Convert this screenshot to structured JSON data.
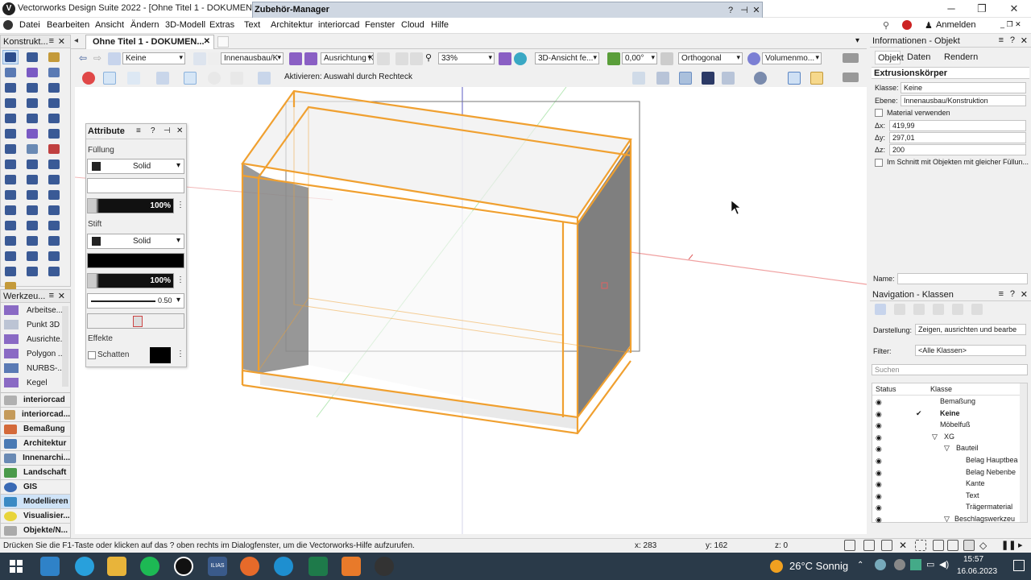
{
  "window": {
    "title": "Vectorworks Design Suite 2022 - [Ohne Titel 1 - DOKUMENT MIT W"
  },
  "dialog": {
    "title": "Zubehör-Manager",
    "help": "?",
    "pin": "⊣",
    "close": "✕"
  },
  "menu": [
    "Datei",
    "Bearbeiten",
    "Ansicht",
    "Ändern",
    "3D-Modell",
    "Extras",
    "Text",
    "Architektur",
    "interiorcad",
    "Fenster",
    "Cloud",
    "Hilfe"
  ],
  "account": {
    "login": "Anmelden"
  },
  "doc_tab": {
    "label": "Ohne Titel 1 - DOKUMEN...",
    "close": "✕"
  },
  "toolbar1": {
    "class_value": "Keine",
    "layer_value": "Innenausbau/K",
    "align_value": "Ausrichtung K...",
    "zoom": "33%",
    "view": "3D-Ansicht fe...",
    "angle": "0,00°",
    "projection": "Orthogonal",
    "render": "Volumenmo..."
  },
  "toolbar2": {
    "hint": "Aktivieren: Auswahl durch Rechteck"
  },
  "palettes": {
    "konstruktion": "Konstrukt...",
    "werkzeug": "Werkzeu..."
  },
  "werkzeug_items": [
    "Arbeitse...",
    "Punkt 3D",
    "Ausrichte...",
    "Polygon ...",
    "NURBS-...",
    "Kegel"
  ],
  "categories": [
    "interiorcad",
    "interiorcad...",
    "Bemaßung",
    "Architektur",
    "Innenarchi...",
    "Landschaft",
    "GIS",
    "Modellieren",
    "Visualisier...",
    "Objekte/N..."
  ],
  "attribute": {
    "title": "Attribute",
    "fill_label": "Füllung",
    "fill_style": "Solid",
    "fill_opacity": "100%",
    "pen_label": "Stift",
    "pen_style": "Solid",
    "pen_opacity": "100%",
    "line_weight": "0.50",
    "effects_label": "Effekte",
    "shadow_label": "Schatten"
  },
  "info": {
    "title": "Informationen - Objekt",
    "tabs": [
      "Objekt",
      "Daten",
      "Rendern"
    ],
    "object_type": "Extrusionskörper",
    "klasse_label": "Klasse:",
    "klasse": "Keine",
    "ebene_label": "Ebene:",
    "ebene": "Innenausbau/Konstruktion",
    "material_label": "Material verwenden",
    "dx_label": "Δx:",
    "dx": "419,99",
    "dy_label": "Δy:",
    "dy": "297,01",
    "dz_label": "Δz:",
    "dz": "200",
    "schnitt_label": "Im Schnitt mit Objekten mit gleicher Füllun...",
    "name_label": "Name:"
  },
  "nav": {
    "title": "Navigation - Klassen",
    "darstellung_label": "Darstellung:",
    "darstellung": "Zeigen, ausrichten und bearbe",
    "filter_label": "Filter:",
    "filter": "<Alle Klassen>",
    "search_placeholder": "Suchen",
    "col_status": "Status",
    "col_klasse": "Klasse",
    "rows": [
      {
        "name": "Bemaßung"
      },
      {
        "name": "Keine"
      },
      {
        "name": "Möbelfuß"
      },
      {
        "name": "XG"
      },
      {
        "name": "Bauteil"
      },
      {
        "name": "Belag Hauptbea"
      },
      {
        "name": "Belag Nebenbe"
      },
      {
        "name": "Kante"
      },
      {
        "name": "Text"
      },
      {
        "name": "Trägermaterial"
      },
      {
        "name": "Beschlagswerkzeu"
      }
    ]
  },
  "status": {
    "help": "Drücken Sie die F1-Taste oder klicken auf das ? oben rechts im Dialogfenster, um die Vectorworks-Hilfe aufzurufen.",
    "x": "x: 283",
    "y": "y: 162",
    "z": "z: 0"
  },
  "taskbar": {
    "weather": "26°C Sonnig",
    "time": "15:57",
    "date": "16.06.2023",
    "ilias": "ILIAS"
  },
  "colors": {
    "accent": "#f0a030",
    "select": "#cfe3f7"
  }
}
